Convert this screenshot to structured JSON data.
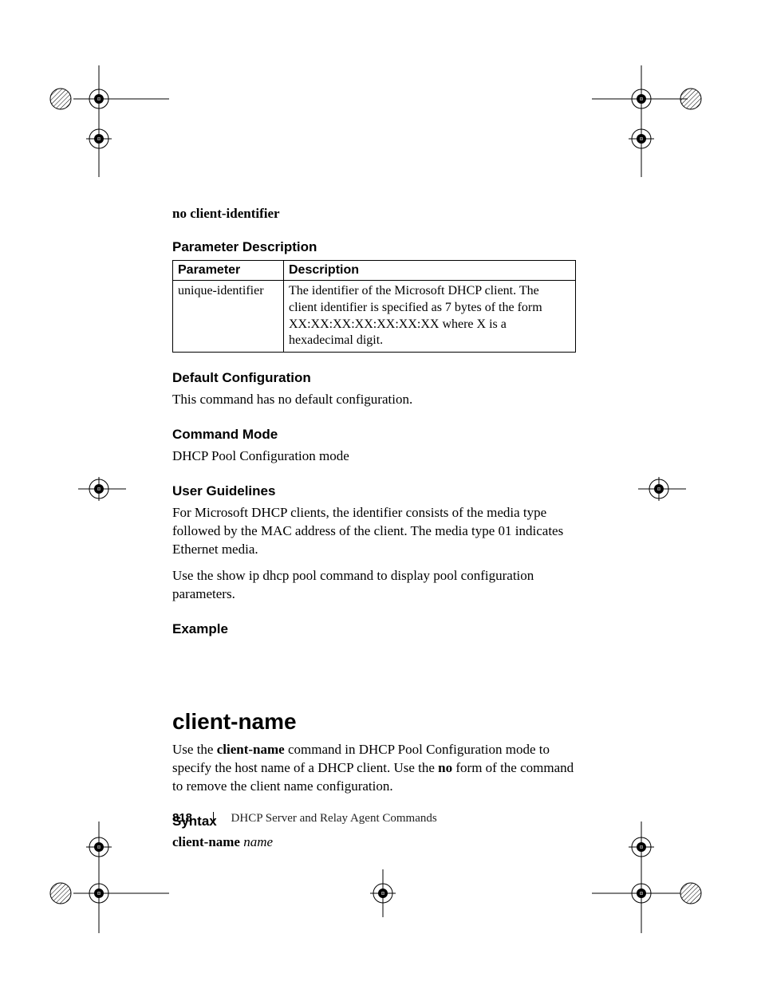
{
  "cmd_neg": "no client-identifier",
  "sections": {
    "param_desc_h": "Parameter Description",
    "default_h": "Default Configuration",
    "default_body": "This command has no default configuration.",
    "mode_h": "Command Mode",
    "mode_body": "DHCP Pool Configuration mode",
    "guidelines_h": "User Guidelines",
    "guidelines_p1": "For Microsoft DHCP clients, the identifier consists of the media type followed by the MAC address of the client. The media type 01 indicates Ethernet media.",
    "guidelines_p2": "Use the show ip dhcp pool command to display pool configuration parameters.",
    "example_h": "Example"
  },
  "table": {
    "col1": "Parameter",
    "col2": "Description",
    "row1_param": "unique-identifier",
    "row1_desc": "The identifier of the Microsoft DHCP client. The client identifier is specified as 7 bytes of the form XX:XX:XX:XX:XX:XX:XX where X is a hexadecimal digit."
  },
  "client_name": {
    "title": "client-name",
    "intro_pre": "Use the ",
    "intro_bold1": "client-name",
    "intro_mid": " command in DHCP Pool Configuration mode to specify the host name of a DHCP client. Use the ",
    "intro_bold2": "no",
    "intro_post": " form of the command to remove the client name configuration.",
    "syntax_h": "Syntax",
    "syntax_bold": "client-name",
    "syntax_ital": "name"
  },
  "footer": {
    "page": "818",
    "chapter": "DHCP Server and Relay Agent Commands"
  }
}
